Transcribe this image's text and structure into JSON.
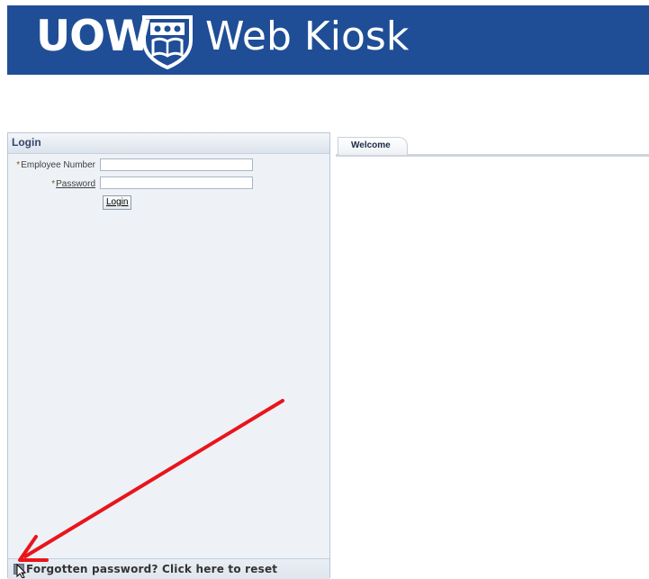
{
  "header": {
    "brand": "UOW",
    "title": "Web Kiosk",
    "background_color": "#1f4e96"
  },
  "login": {
    "panel_title": "Login",
    "employee_label": "Employee Number",
    "password_label": "Password",
    "required_marker": "*",
    "employee_value": "",
    "password_value": "",
    "login_button": "Login"
  },
  "footer": {
    "reset_link": "Forgotten password? Click here to reset"
  },
  "tabs": [
    {
      "label": "Welcome",
      "active": true
    }
  ],
  "annotation": {
    "arrow_color": "#e8151b"
  }
}
